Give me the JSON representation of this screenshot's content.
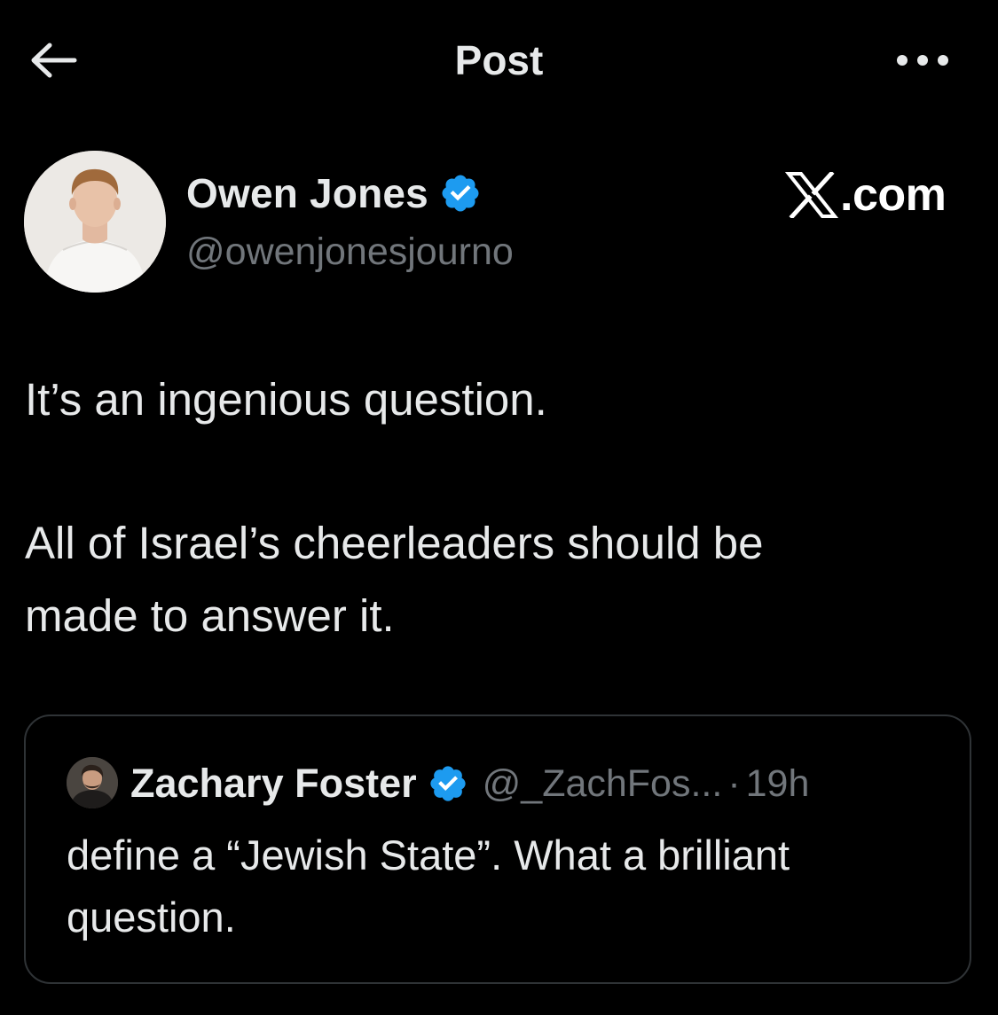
{
  "header": {
    "title": "Post",
    "back_icon": "arrow-left-icon",
    "more_icon": "more-horizontal-icon"
  },
  "post": {
    "author": {
      "name": "Owen Jones",
      "handle": "@owenjonesjourno",
      "verified": true
    },
    "brand": {
      "x_glyph": "𝕏",
      "suffix": ".com"
    },
    "text_lines": [
      "It’s an ingenious question.",
      "All of Israel’s cheerleaders should be",
      "made to answer it."
    ]
  },
  "quote": {
    "author": {
      "name": "Zachary Foster",
      "handle": "@_ZachFos...",
      "verified": true
    },
    "separator": "·",
    "time": "19h",
    "text_lines": [
      "define a “Jewish State”. What a brilliant",
      "question."
    ]
  },
  "colors": {
    "background": "#000000",
    "primary_text": "#e7e9ea",
    "secondary_text": "#71767b",
    "verified_blue": "#1d9bf0",
    "card_border": "#2f3336"
  }
}
